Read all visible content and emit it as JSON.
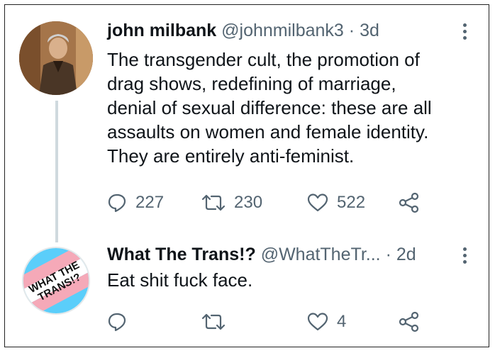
{
  "tweets": [
    {
      "display_name": "john milbank",
      "handle": "@johnmilbank3",
      "time": "· 3d",
      "text_lines": [
        "The transgender cult, the promotion of",
        "drag shows, redefining of marriage,",
        "denial of sexual difference: these are all",
        "assaults on women and female identity.",
        "They are entirely anti-feminist."
      ],
      "replies": "227",
      "retweets": "230",
      "likes": "522"
    },
    {
      "display_name": "What The Trans!?",
      "handle": "@WhatTheTr...",
      "time": "· 2d",
      "text_lines": [
        "Eat shit fuck face."
      ],
      "replies": "",
      "retweets": "",
      "likes": "4",
      "avatar_text": [
        "WHAT THE",
        "TRANS!?"
      ]
    }
  ],
  "colors": {
    "text": "#0f1419",
    "secondary": "#536471",
    "thread_line": "#cfd9de",
    "trans_blue": "#5bcefa",
    "trans_pink": "#f5a9b8"
  },
  "icons": [
    "reply-icon",
    "retweet-icon",
    "like-icon",
    "share-icon",
    "more-icon"
  ]
}
